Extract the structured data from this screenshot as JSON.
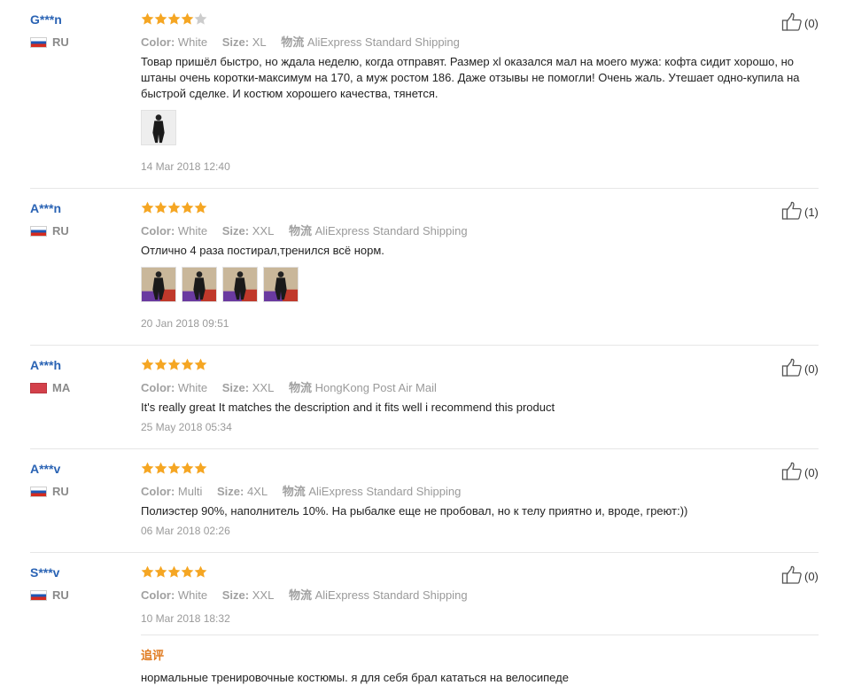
{
  "colors": {
    "star": "#f5a623",
    "star_empty": "#cccccc",
    "username": "#2a63b4",
    "followup_title": "#e07a1f"
  },
  "labels": {
    "color": "Color:",
    "size": "Size:",
    "shipping": "物流"
  },
  "reviews": [
    {
      "user": "G***n",
      "country": "RU",
      "flag": "russia-flag",
      "rating": 4,
      "color": "White",
      "size": "XL",
      "shipping": "AliExpress Standard Shipping",
      "text": "Товар пришёл быстро, но ждала неделю, когда отправят. Размер xl оказался мал на моего мужа: кофта сидит хорошо, но штаны очень коротки-максимум на 170, а муж ростом 186. Даже отзывы не помогли! Очень жаль. Утешает одно-купила на быстрой сделке. И костюм хорошего качества, тянется.",
      "photo_count": 1,
      "date": "14 Mar 2018 12:40",
      "likes": "(0)"
    },
    {
      "user": "A***n",
      "country": "RU",
      "flag": "russia-flag",
      "rating": 5,
      "color": "White",
      "size": "XXL",
      "shipping": "AliExpress Standard Shipping",
      "text": "Отлично 4 раза постирал,тренился всё норм.",
      "photo_count": 4,
      "date": "20 Jan 2018 09:51",
      "likes": "(1)"
    },
    {
      "user": "A***h",
      "country": "MA",
      "flag": "morocco-flag",
      "rating": 5,
      "color": "White",
      "size": "XXL",
      "shipping": "HongKong Post Air Mail",
      "text": "It's really great It matches the description and it fits well i recommend this product",
      "photo_count": 0,
      "date": "25 May 2018 05:34",
      "likes": "(0)"
    },
    {
      "user": "A***v",
      "country": "RU",
      "flag": "russia-flag",
      "rating": 5,
      "color": "Multi",
      "size": "4XL",
      "shipping": "AliExpress Standard Shipping",
      "text": "Полиэстер 90%, наполнитель 10%. На рыбалке еще не пробовал, но к телу приятно и, вроде, греют:))",
      "photo_count": 0,
      "date": "06 Mar 2018 02:26",
      "likes": "(0)"
    },
    {
      "user": "S***v",
      "country": "RU",
      "flag": "russia-flag",
      "rating": 5,
      "color": "White",
      "size": "XXL",
      "shipping": "AliExpress Standard Shipping",
      "text": "",
      "photo_count": 0,
      "date": "10 Mar 2018 18:32",
      "likes": "(0)",
      "followup_title": "追评",
      "followup_text": "нормальные тренировочные костюмы. я для себя брал кататься на велосипеде"
    }
  ]
}
